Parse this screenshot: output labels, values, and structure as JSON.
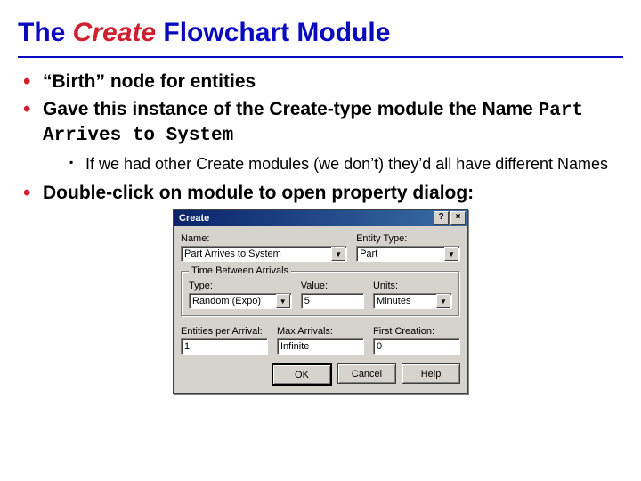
{
  "title": {
    "prefix": "The ",
    "em": "Create",
    "suffix": " Flowchart Module"
  },
  "bullets": {
    "b1": "“Birth” node for entities",
    "b2": {
      "pre": "Gave this instance of the Create-type module the Name ",
      "code": "Part Arrives to System"
    },
    "b2_sub": "If we had other Create modules (we don’t) they’d all have different Names",
    "b3": "Double-click on module to open property dialog:"
  },
  "dialog": {
    "title": "Create",
    "help_glyph": "?",
    "close_glyph": "×",
    "labels": {
      "name": "Name:",
      "entity_type": "Entity Type:",
      "group": "Time Between Arrivals",
      "type": "Type:",
      "value": "Value:",
      "units": "Units:",
      "epa": "Entities per Arrival:",
      "maxa": "Max Arrivals:",
      "first": "First Creation:"
    },
    "values": {
      "name": "Part Arrives to System",
      "entity_type": "Part",
      "type": "Random (Expo)",
      "value": "5",
      "units": "Minutes",
      "epa": "1",
      "maxa": "Infinite",
      "first": "0"
    },
    "buttons": {
      "ok": "OK",
      "cancel": "Cancel",
      "help": "Help"
    }
  }
}
